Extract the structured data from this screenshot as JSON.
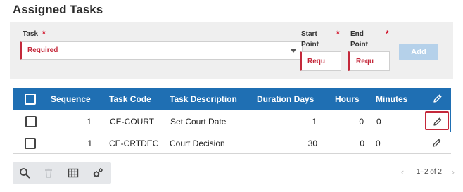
{
  "title": "Assigned Tasks",
  "form": {
    "task_label": "Task",
    "task_value": "Required",
    "start_point_label": "Start Point",
    "end_point_label": "End Point",
    "required_marker": "*",
    "start_point_value": "Requ",
    "end_point_value": "Requ",
    "add_label": "Add"
  },
  "grid": {
    "columns": [
      "Sequence",
      "Task Code",
      "Task Description",
      "Duration Days",
      "Hours",
      "Minutes"
    ],
    "rows": [
      {
        "sequence": "1",
        "task_code": "CE-COURT",
        "task_description": "Set Court Date",
        "duration_days": "1",
        "hours": "0",
        "minutes": "0"
      },
      {
        "sequence": "1",
        "task_code": "CE-CRTDEC",
        "task_description": "Court Decision",
        "duration_days": "30",
        "hours": "0",
        "minutes": "0"
      }
    ]
  },
  "toolbar": {
    "icons": [
      "search-icon",
      "trash-icon",
      "grid-view-icon",
      "settings-icon"
    ]
  },
  "pager": {
    "range_text": "1–2 of 2"
  },
  "colors": {
    "header_blue": "#1f6fb3",
    "required_red": "#c4283a",
    "add_button": "#b5d1ea",
    "panel_bg": "#efefef"
  }
}
